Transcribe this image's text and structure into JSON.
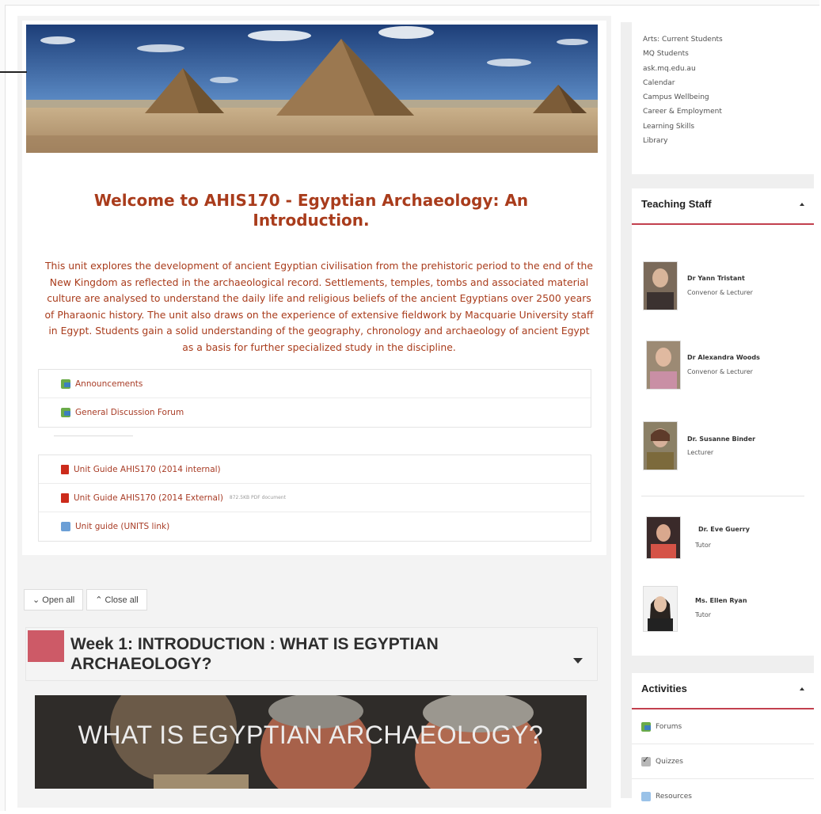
{
  "course": {
    "title": "Welcome to AHIS170 - Egyptian Archaeology: An Introduction.",
    "description": "This unit explores the development of ancient Egyptian civilisation from the prehistoric period to the end of the New Kingdom as reflected in the archaeological record. Settlements, temples, tombs and associated material culture are analysed to understand the daily life and religious beliefs of the ancient Egyptians over 2500 years of Pharaonic history. The unit also draws on the experience of extensive fieldwork by Macquarie University staff in Egypt. Students gain a solid understanding of the geography, chronology and archaeology of ancient Egypt as a basis for further specialized study in the discipline."
  },
  "forums": [
    {
      "label": "Announcements",
      "icon": "forum-icon"
    },
    {
      "label": "General Discussion Forum",
      "icon": "forum-icon"
    }
  ],
  "documents": [
    {
      "label": "Unit Guide AHIS170 (2014 internal)",
      "icon": "pdf-icon",
      "meta": ""
    },
    {
      "label": "Unit Guide AHIS170 (2014 External)",
      "icon": "pdf-icon",
      "meta": "872.5KB PDF document"
    },
    {
      "label": "Unit guide (UNITS link)",
      "icon": "url-icon",
      "meta": ""
    }
  ],
  "toggles": {
    "open_all": "⌄ Open all",
    "close_all": "⌃ Close all"
  },
  "week": {
    "title": "Week 1: INTRODUCTION : WHAT IS EGYPTIAN ARCHAEOLOGY?",
    "video_title": "WHAT IS EGYPTIAN ARCHAEOLOGY?"
  },
  "sidebar": {
    "links": [
      "Arts: Current Students",
      "MQ Students",
      "ask.mq.edu.au",
      "Calendar",
      "Campus Wellbeing",
      "Career & Employment",
      "Learning Skills",
      "Library"
    ],
    "teaching_staff": {
      "title": "Teaching Staff",
      "members": [
        {
          "name": "Dr Yann Tristant",
          "role": "Convenor & Lecturer"
        },
        {
          "name": "Dr Alexandra Woods",
          "role": "Convenor & Lecturer"
        },
        {
          "name": "Dr. Susanne Binder",
          "role": "Lecturer"
        },
        {
          "name": "Dr. Eve Guerry",
          "role": "Tutor"
        },
        {
          "name": "Ms. Ellen Ryan",
          "role": "Tutor"
        }
      ]
    },
    "activities": {
      "title": "Activities",
      "items": [
        {
          "label": "Forums",
          "icon": "forum-icon"
        },
        {
          "label": "Quizzes",
          "icon": "quiz-icon"
        },
        {
          "label": "Resources",
          "icon": "resource-icon"
        }
      ]
    }
  },
  "colors": {
    "title": "#a93c1c",
    "accent": "#c2404e",
    "week_swatch": "#cd5a67",
    "link": "#a83c26"
  }
}
